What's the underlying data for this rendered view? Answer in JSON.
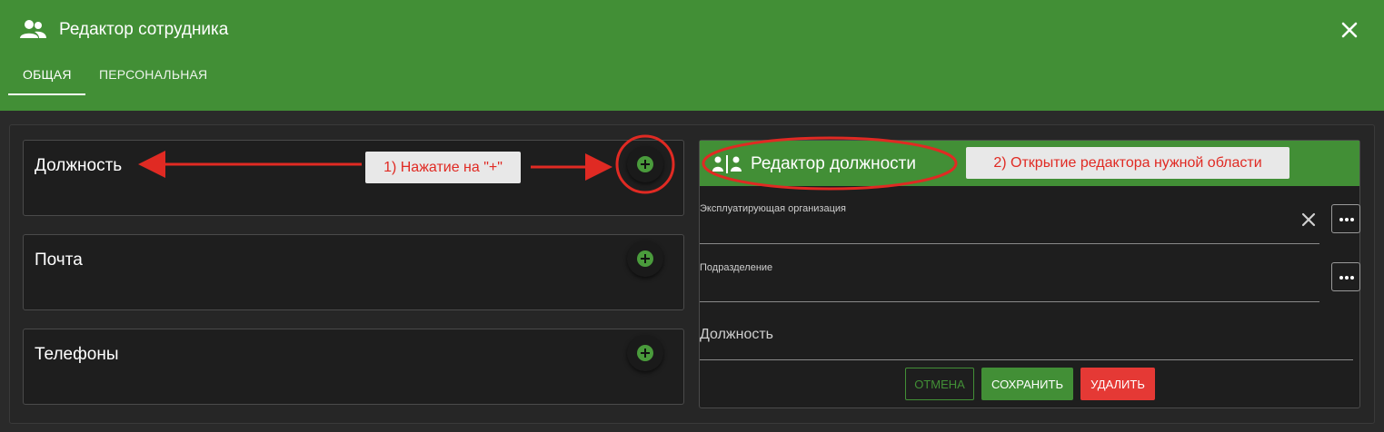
{
  "window": {
    "title": "Редактор сотрудника",
    "tabs": [
      {
        "label": "ОБЩАЯ",
        "active": true
      },
      {
        "label": "ПЕРСОНАЛЬНАЯ",
        "active": false
      }
    ],
    "icons": {
      "title": "people-icon",
      "close": "close-icon"
    }
  },
  "cards": [
    {
      "title": "Должность",
      "action_icon": "add-icon"
    },
    {
      "title": "Почта",
      "action_icon": "add-icon"
    },
    {
      "title": "Телефоны",
      "action_icon": "add-icon"
    }
  ],
  "editor": {
    "title": "Редактор должности",
    "icon": "position-editor-icon",
    "fields": [
      {
        "label": "Эксплуатирующая организация",
        "value": ""
      },
      {
        "label": "Подразделение",
        "value": ""
      }
    ],
    "position_label": "Должность",
    "buttons": {
      "cancel": "ОТМЕНА",
      "save": "СОХРАНИТЬ",
      "delete": "УДАЛИТЬ"
    }
  },
  "annotations": {
    "step1": "1) Нажатие на \"+\"",
    "step2": "2) Открытие редактора нужной области"
  },
  "colors": {
    "primary": "#428f36",
    "danger": "#e53935",
    "annotation": "#e02a23",
    "background": "#1e1e1e"
  }
}
